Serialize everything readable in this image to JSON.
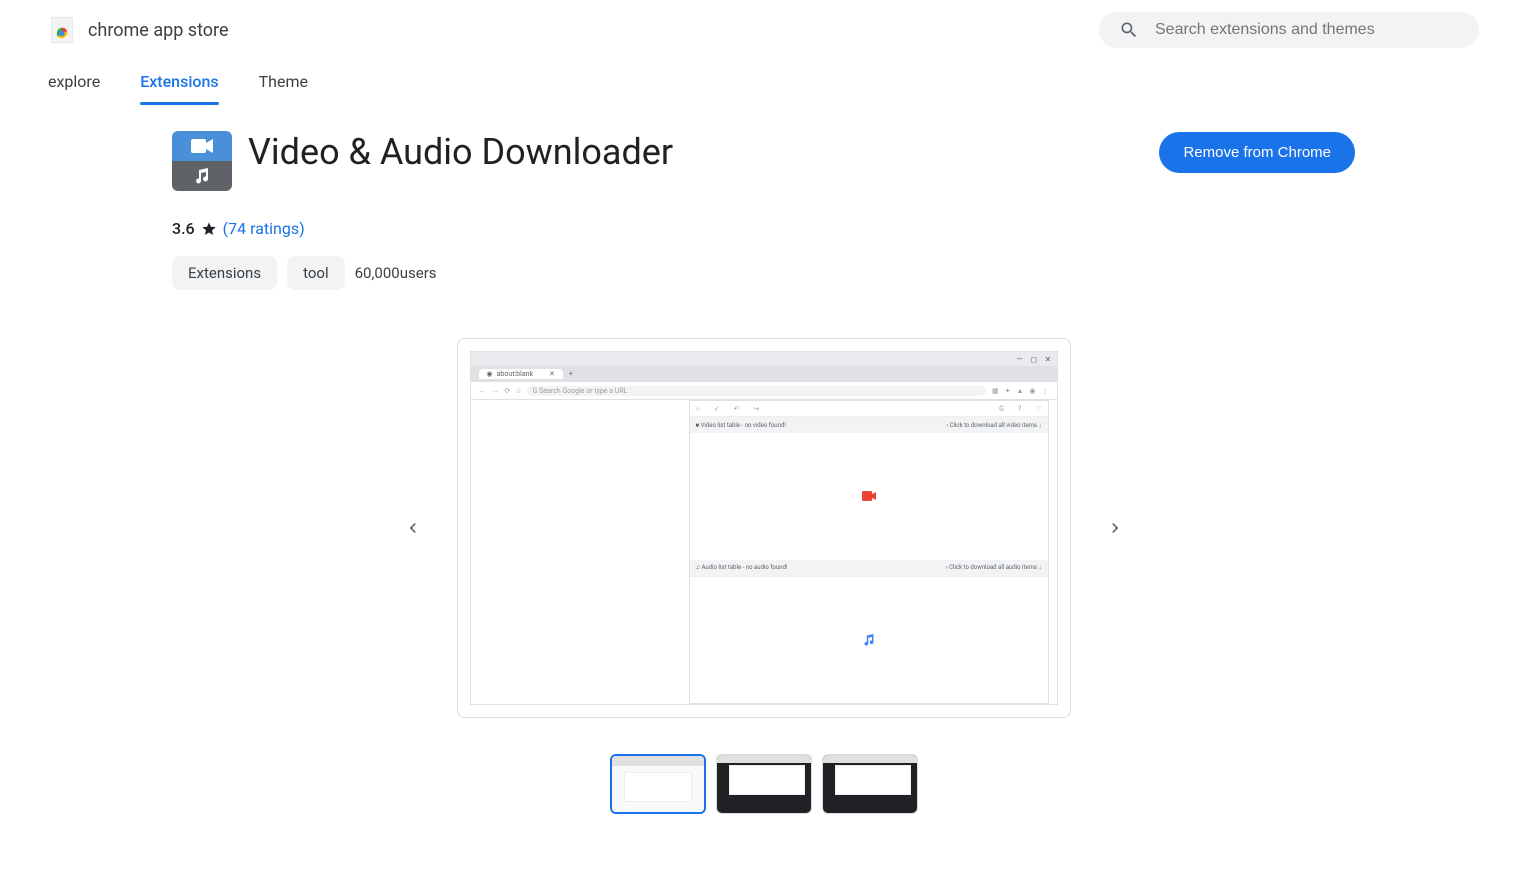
{
  "header": {
    "store_title": "chrome app store"
  },
  "search": {
    "placeholder": "Search extensions and themes"
  },
  "nav": {
    "tabs": [
      {
        "label": "explore"
      },
      {
        "label": "Extensions"
      },
      {
        "label": "Theme"
      }
    ]
  },
  "extension": {
    "title": "Video & Audio Downloader",
    "rating": "3.6",
    "ratings_link_prefix": "(",
    "ratings_count": "74 ratings",
    "ratings_link_suffix": ")",
    "tags": [
      {
        "label": "Extensions"
      },
      {
        "label": "tool"
      }
    ],
    "users": "60,000users",
    "remove_label": "Remove from Chrome"
  },
  "screenshot": {
    "tab_title": "about:blank",
    "addr_placeholder": "Search Google or type a URL",
    "toolbar_left": [
      "○",
      "✓",
      "↶",
      "↪"
    ],
    "toolbar_right": [
      "G",
      "?",
      "♡"
    ],
    "video_header_left": "■  Video list table - no video found!",
    "video_header_right": "›  Click to download all video items  ↓",
    "audio_header_left": "♫  Audio list table - no audio found!",
    "audio_header_right": "›  Click to download all audio items  ↓"
  }
}
